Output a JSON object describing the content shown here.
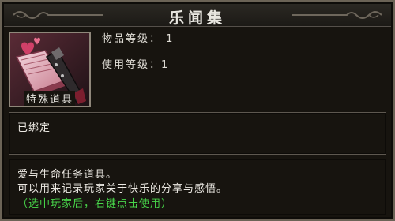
{
  "item": {
    "name": "乐闻集",
    "type": "特殊道具",
    "icon": "love-book-icon",
    "stats": [
      {
        "label": "物品等级：",
        "value": "1"
      },
      {
        "label": "使用等级：",
        "value": "1"
      }
    ],
    "binding": "已绑定",
    "description": [
      "爱与生命任务道具。",
      "可以用来记录玩家关于快乐的分享与感悟。",
      "（选中玩家后，右键点击使用）"
    ]
  },
  "colors": {
    "hint_text": "#48d64a",
    "text": "#ebe8e2",
    "border": "#6b6356"
  }
}
